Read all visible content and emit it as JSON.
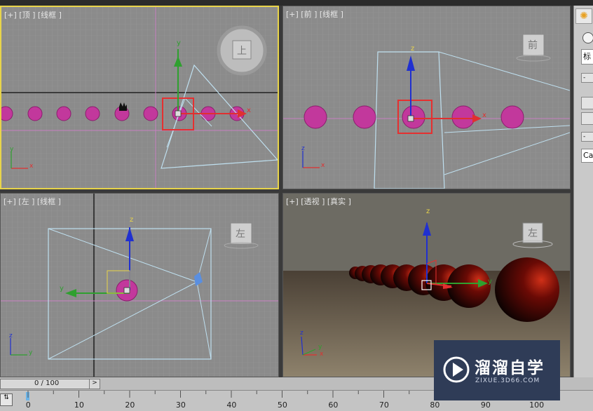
{
  "viewports": {
    "top": {
      "label": "[+] [顶 ] [线框 ]",
      "viewcube": "上",
      "axis_x": "x",
      "axis_y": "y"
    },
    "front": {
      "label": "[+] [前 ] [线框 ]",
      "viewcube": "前",
      "axis_x": "x",
      "axis_z": "z"
    },
    "left": {
      "label": "[+] [左 ] [线框 ]",
      "viewcube": "左",
      "axis_y": "y",
      "axis_z": "z"
    },
    "perspective": {
      "label": "[+] [透视 ] [真实 ]",
      "viewcube": "左",
      "axis_x": "x",
      "axis_y": "y",
      "axis_z": "z"
    }
  },
  "time_slider": {
    "value": "0 / 100",
    "next": ">"
  },
  "ruler": {
    "ticks": [
      "0",
      "10",
      "20",
      "30",
      "40",
      "50",
      "60",
      "70",
      "80",
      "90",
      "100"
    ]
  },
  "command_panel": {
    "field1": "标",
    "field2": "Ca"
  },
  "watermark": {
    "title": "溜溜自学",
    "url": "ZIXUE.3D66.COM"
  },
  "colors": {
    "active_border": "#e8d44a",
    "sphere": "#c2389c",
    "highlight": "#e53030",
    "gizmo_x": "#e03030",
    "gizmo_y": "#2fa02f",
    "gizmo_z": "#2030d0"
  }
}
